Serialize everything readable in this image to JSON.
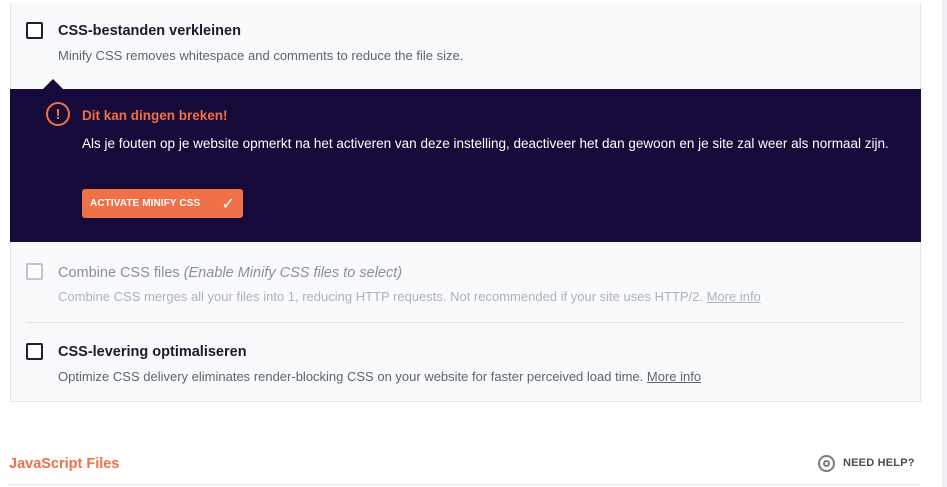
{
  "options": {
    "minify_css": {
      "title": "CSS-bestanden verkleinen",
      "description": "Minify CSS removes whitespace and comments to reduce the file size."
    },
    "combine_css": {
      "title": "Combine CSS files",
      "title_note": "(Enable Minify CSS files to select)",
      "description": "Combine CSS merges all your files into 1, reducing HTTP requests. Not recommended if your site uses HTTP/2.",
      "link": "More info"
    },
    "optimize_css": {
      "title": "CSS-levering optimaliseren",
      "description": "Optimize CSS delivery eliminates render-blocking CSS on your website for faster perceived load time.",
      "link": "More info"
    }
  },
  "warning": {
    "icon": "exclamation-circle-icon",
    "title": "Dit kan dingen breken!",
    "text": "Als je fouten op je website opmerkt na het activeren van deze instelling, deactiveer het dan gewoon en je site zal weer als normaal zijn.",
    "button_label": "ACTIVATE MINIFY CSS",
    "button_icon": "checkmark-icon"
  },
  "section": {
    "title": "JavaScript Files",
    "help_label": "NEED HELP?",
    "help_icon": "lifebuoy-icon"
  },
  "colors": {
    "accent": "#f07048",
    "warning_bg": "#150a3a",
    "card_bg": "#f9fafb"
  }
}
